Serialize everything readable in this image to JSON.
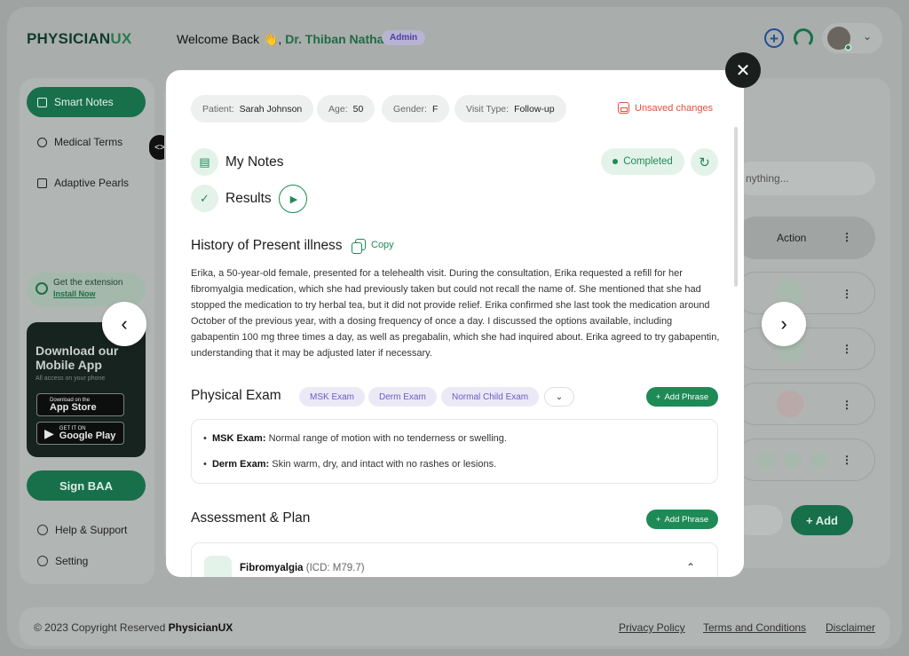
{
  "app": {
    "logo_main": "PHYSICIAN",
    "logo_accent": "UX",
    "welcome": "Welcome Back 👋,",
    "doctor_name": "Dr. Thiban Nathan",
    "role_badge": "Admin"
  },
  "sidebar": {
    "items": [
      {
        "label": "Smart Notes",
        "icon": "notes-icon",
        "active": true
      },
      {
        "label": "Medical Terms",
        "icon": "pill-icon",
        "active": false
      },
      {
        "label": "Adaptive Pearls",
        "icon": "document-icon",
        "active": false
      }
    ],
    "extension": {
      "title": "Get the extension",
      "link": "Install Now"
    },
    "mobile_card": {
      "title": "Download our Mobile App",
      "subtitle": "All access on your phone",
      "app_store_small": "Download on the",
      "app_store_big": "App Store",
      "google_play_small": "GET IT ON",
      "google_play_big": "Google Play"
    },
    "sign_baa": "Sign BAA",
    "footer_items": [
      {
        "label": "Help & Support",
        "icon": "help-icon"
      },
      {
        "label": "Setting",
        "icon": "gear-icon"
      }
    ]
  },
  "background_table": {
    "search_placeholder": "nything...",
    "action_header": "Action",
    "add_button": "+ Add"
  },
  "footer": {
    "copyright_prefix": "© 2023 Copyright Reserved",
    "brand": "PhysicianUX",
    "links": [
      "Privacy Policy",
      "Terms and Conditions",
      "Disclaimer"
    ]
  },
  "modal": {
    "patient_label": "Patient:",
    "patient_value": "Sarah Johnson",
    "age_label": "Age:",
    "age_value": "50",
    "gender_label": "Gender:",
    "gender_value": "F",
    "visit_label": "Visit Type:",
    "visit_value": "Follow-up",
    "unsaved": "Unsaved changes",
    "my_notes": "My Notes",
    "results": "Results",
    "status": "Completed",
    "hpi_title": "History of Present illness",
    "copy_label": "Copy",
    "hpi_text": "Erika, a 50-year-old female, presented for a telehealth visit. During the consultation, Erika requested a refill for her fibromyalgia medication, which she had previously taken but could not recall the name of. She mentioned that she had stopped the medication to try herbal tea, but it did not provide relief. Erika confirmed she last took the medication around October of the previous year, with a dosing frequency of once a day. I discussed the options available, including gabapentin 100 mg three times a day, as well as pregabalin, which she had inquired about. Erika agreed to try gabapentin, understanding that it may be adjusted later if necessary.",
    "pe_title": "Physical Exam",
    "pe_chips": [
      "MSK Exam",
      "Derm Exam",
      "Normal Child Exam"
    ],
    "add_phrase": "Add Phrase",
    "pe_items": [
      {
        "label": "MSK Exam:",
        "text": "Normal range of motion with no tenderness or swelling."
      },
      {
        "label": "Derm Exam:",
        "text": "Skin warm, dry, and intact with no rashes or lesions."
      }
    ],
    "ap_title": "Assessment & Plan",
    "ap_item": {
      "name": "Fibromyalgia",
      "icd": "(ICD: M79.7)"
    }
  },
  "colors": {
    "brand_green": "#1e8a55",
    "warning_red": "#e0513d",
    "chip_purple": "#6b5bc2"
  }
}
